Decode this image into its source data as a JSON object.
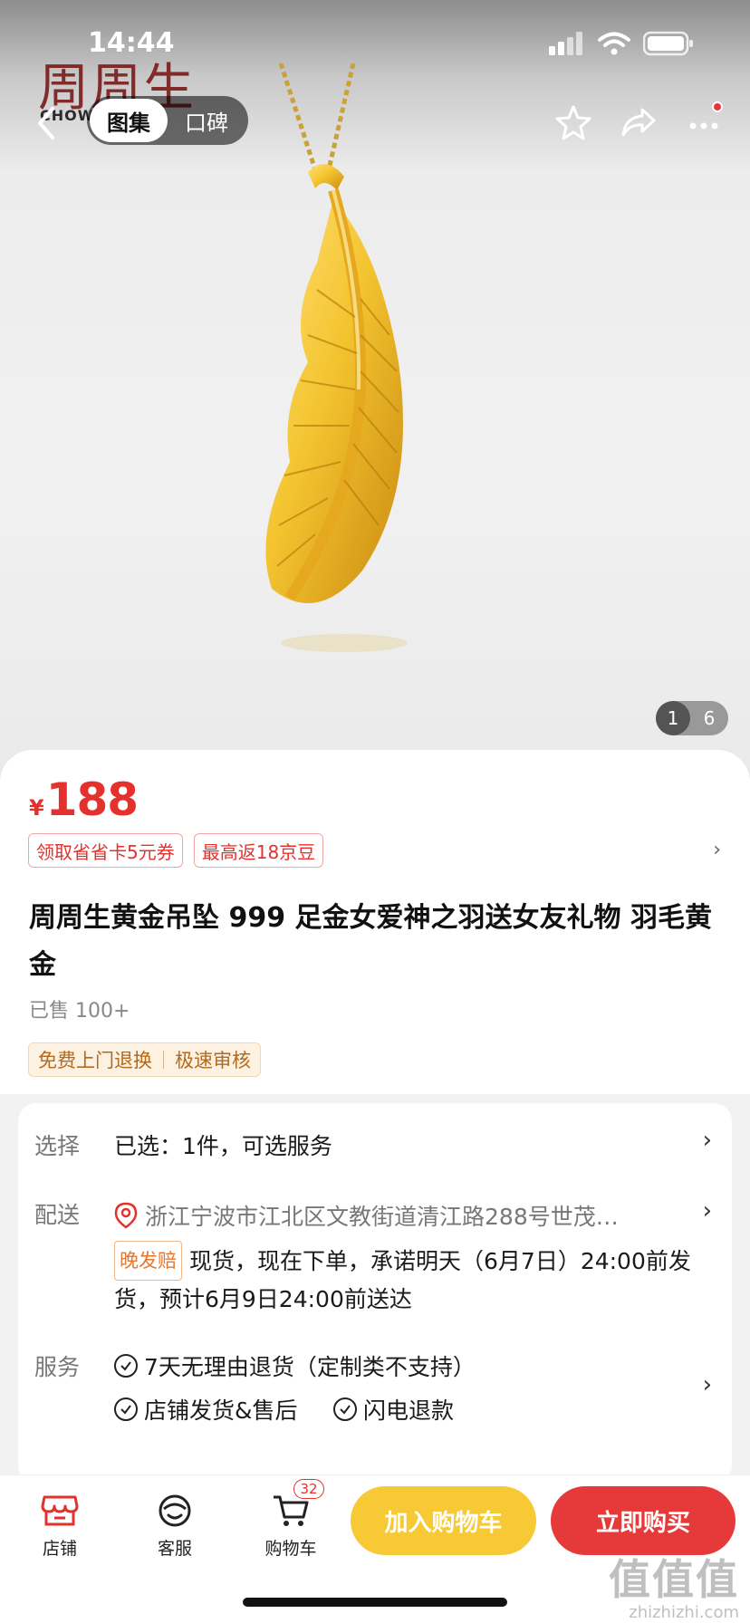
{
  "status_bar": {
    "time": "14:44"
  },
  "brand": {
    "logo_text": "周周生",
    "sub_text": "CHOW               G"
  },
  "nav": {
    "tabs": [
      {
        "label": "图集",
        "active": true
      },
      {
        "label": "口碑",
        "active": false
      }
    ],
    "icons": [
      "star-icon",
      "share-icon",
      "more-icon"
    ]
  },
  "gallery": {
    "current": "1",
    "total": "6"
  },
  "product": {
    "currency": "¥",
    "price": "188",
    "coupons": [
      "领取省省卡5元券",
      "最高返18京豆"
    ],
    "title": "周周生黄金吊坠 999 足金女爱神之羽送女友礼物 羽毛黄金",
    "sold": "已售 100+",
    "tags": [
      "免费上门退换",
      "极速审核"
    ]
  },
  "details": {
    "select": {
      "label": "选择",
      "value": "已选：1件，可选服务"
    },
    "delivery": {
      "label": "配送",
      "address": "浙江宁波市江北区文教街道清江路288号世茂…",
      "badge": "晚发赔",
      "text": "现货，现在下单，承诺明天（6月7日）24:00前发货，预计6月9日24:00前送达"
    },
    "service": {
      "label": "服务",
      "items": [
        "7天无理由退货（定制类不支持）",
        "店铺发货&售后",
        "闪电退款"
      ]
    }
  },
  "bottom_bar": {
    "shop": "店铺",
    "service": "客服",
    "cart": "购物车",
    "cart_count": "32",
    "add_to_cart": "加入购物车",
    "buy_now": "立即购买"
  },
  "watermark": {
    "big": "值值值",
    "small": "zhizhizhi.com"
  },
  "colors": {
    "price_red": "#e5312d",
    "cart_yellow": "#f7c934",
    "buy_red": "#e63a3a"
  }
}
